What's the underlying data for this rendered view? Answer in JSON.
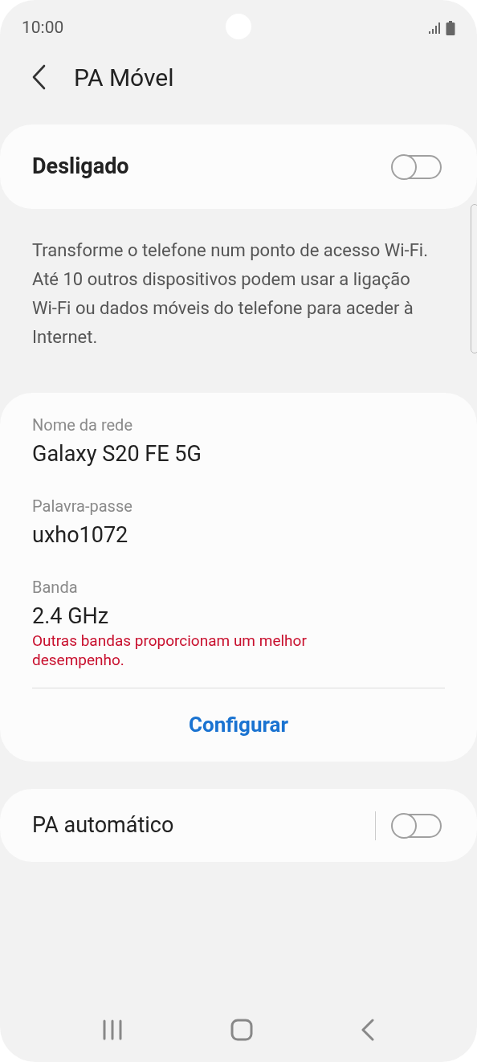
{
  "status_bar": {
    "time": "10:00"
  },
  "header": {
    "title": "PA Móvel"
  },
  "main_switch": {
    "label": "Desligado",
    "on": false
  },
  "description": "Transforme o telefone num ponto de acesso Wi-Fi. Até 10 outros dispositivos podem usar a ligação Wi-Fi ou dados móveis do telefone para aceder à Internet.",
  "network_card": {
    "fields": [
      {
        "label": "Nome da rede",
        "value": "Galaxy S20 FE 5G"
      },
      {
        "label": "Palavra-passe",
        "value": "uxho1072"
      },
      {
        "label": "Banda",
        "value": "2.4 GHz",
        "warning": "Outras bandas proporcionam um melhor desempenho."
      }
    ],
    "action": "Configurar"
  },
  "auto_hotspot": {
    "label": "PA automático",
    "on": false
  }
}
